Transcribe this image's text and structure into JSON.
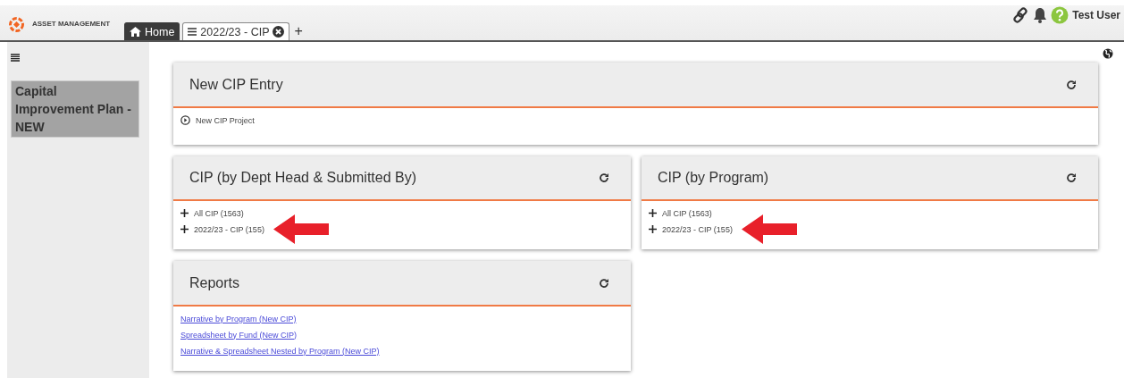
{
  "app": {
    "title": "ASSET MANAGEMENT"
  },
  "tabs": [
    {
      "label": "Home",
      "kind": "home",
      "selected": true
    },
    {
      "label": "2022/23 - CIP",
      "kind": "list",
      "selected": false
    }
  ],
  "add_tab": "+",
  "user": {
    "name": "Test User"
  },
  "sidebar": {
    "items": [
      {
        "label": "Capital Improvement Plan - NEW",
        "selected": true
      }
    ]
  },
  "panels": [
    {
      "title": "New CIP Entry",
      "items": [
        {
          "kind": "action",
          "label": "New CIP Project",
          "annotated": false
        }
      ]
    },
    {
      "title": "CIP (by Dept Head & Submitted By)",
      "items": [
        {
          "kind": "expandable",
          "label": "All CIP (1563)",
          "annotated": false
        },
        {
          "kind": "expandable",
          "label": "2022/23 - CIP (155)",
          "annotated": true
        }
      ]
    },
    {
      "title": "CIP (by Program)",
      "items": [
        {
          "kind": "expandable",
          "label": "All CIP (1563)",
          "annotated": false
        },
        {
          "kind": "expandable",
          "label": "2022/23 - CIP (155)",
          "annotated": true
        }
      ]
    },
    {
      "title": "Reports",
      "items": [
        {
          "kind": "link",
          "label": "Narrative by Program (New CIP)",
          "annotated": false
        },
        {
          "kind": "link",
          "label": "Spreadsheet by Fund (New CIP)",
          "annotated": false
        },
        {
          "kind": "link",
          "label": "Narrative & Spreadsheet Nested by Program (New CIP)",
          "annotated": false
        }
      ]
    }
  ]
}
